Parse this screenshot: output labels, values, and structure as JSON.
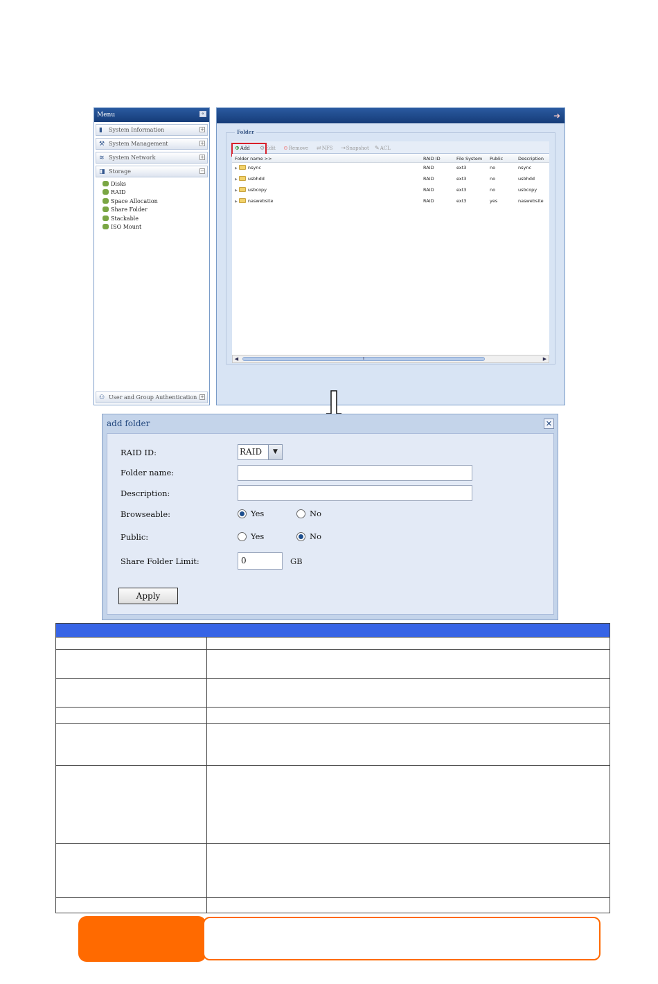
{
  "menu": {
    "title": "Menu",
    "sections": [
      {
        "label": "System Information",
        "icon": "book-icon",
        "toggle": "+"
      },
      {
        "label": "System Management",
        "icon": "wrench-icon",
        "toggle": "+"
      },
      {
        "label": "System Network",
        "icon": "network-icon",
        "toggle": "+"
      },
      {
        "label": "Storage",
        "icon": "storage-icon",
        "toggle": "−"
      }
    ],
    "storage_items": [
      "Disks",
      "RAID",
      "Space Allocation",
      "Share Folder",
      "Stackable",
      "ISO Mount"
    ],
    "bottom_section": {
      "label": "User and Group Authentication",
      "toggle": "+"
    }
  },
  "folder_panel": {
    "legend": "Folder",
    "toolbar": {
      "add": "Add",
      "edit": "Edit",
      "remove": "Remove",
      "nfs": "NFS",
      "snapshot": "Snapshot",
      "acl": "ACL"
    },
    "columns": [
      "Folder name >>",
      "RAID ID",
      "File System",
      "Public",
      "Description"
    ],
    "rows": [
      {
        "name": "nsync",
        "raid": "RAID",
        "fs": "ext3",
        "public": "no",
        "desc": "nsync"
      },
      {
        "name": "usbhdd",
        "raid": "RAID",
        "fs": "ext3",
        "public": "no",
        "desc": "usbhdd"
      },
      {
        "name": "usbcopy",
        "raid": "RAID",
        "fs": "ext3",
        "public": "no",
        "desc": "usbcopy"
      },
      {
        "name": "naswebsite",
        "raid": "RAID",
        "fs": "ext3",
        "public": "yes",
        "desc": "naswebsite"
      }
    ]
  },
  "dialog": {
    "title": "add folder",
    "raid_label": "RAID ID:",
    "raid_value": "RAID",
    "folder_name_label": "Folder name:",
    "folder_name_value": "",
    "description_label": "Description:",
    "description_value": "",
    "browseable_label": "Browseable:",
    "browseable_selected": "Yes",
    "public_label": "Public:",
    "public_selected": "No",
    "yes": "Yes",
    "no": "No",
    "limit_label": "Share Folder Limit:",
    "limit_value": "0",
    "limit_unit": "GB",
    "apply": "Apply"
  },
  "colors": {
    "header_blue": "#1e4a8c",
    "table_header": "#3764e6",
    "note_orange": "#ff6a00"
  }
}
